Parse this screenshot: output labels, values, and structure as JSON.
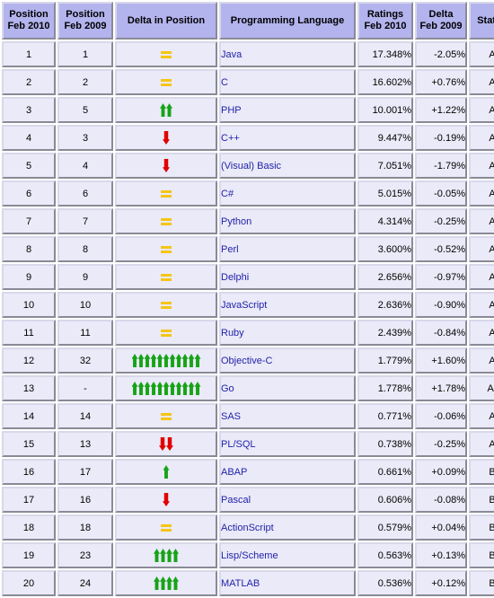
{
  "table": {
    "headers": [
      {
        "line1": "Position",
        "line2": "Feb 2010",
        "name": "position-2010"
      },
      {
        "line1": "Position",
        "line2": "Feb 2009",
        "name": "position-2009"
      },
      {
        "line1": "Delta in Position",
        "line2": "",
        "name": "delta-in-position"
      },
      {
        "line1": "Programming Language",
        "line2": "",
        "name": "programming-language"
      },
      {
        "line1": "Ratings",
        "line2": "Feb 2010",
        "name": "ratings-2010"
      },
      {
        "line1": "Delta",
        "line2": "Feb 2009",
        "name": "delta-2009"
      },
      {
        "line1": "Status",
        "line2": "",
        "name": "status"
      }
    ],
    "colors": {
      "header_bg": "#b3b3ee",
      "cell_bg": "#eaeaf8",
      "border": "#d8d8ea",
      "link": "#2222aa",
      "arrow_up": "#17a317",
      "arrow_down": "#e00000",
      "equal": "#f5c518"
    },
    "rows": [
      {
        "pos2010": "1",
        "pos2009": "1",
        "delta_dir": "equal",
        "delta_count": 1,
        "language": "Java",
        "ratings": "17.348%",
        "delta": "-2.05%",
        "status": "A"
      },
      {
        "pos2010": "2",
        "pos2009": "2",
        "delta_dir": "equal",
        "delta_count": 1,
        "language": "C",
        "ratings": "16.602%",
        "delta": "+0.76%",
        "status": "A"
      },
      {
        "pos2010": "3",
        "pos2009": "5",
        "delta_dir": "up",
        "delta_count": 2,
        "language": "PHP",
        "ratings": "10.001%",
        "delta": "+1.22%",
        "status": "A"
      },
      {
        "pos2010": "4",
        "pos2009": "3",
        "delta_dir": "down",
        "delta_count": 1,
        "language": "C++",
        "ratings": "9.447%",
        "delta": "-0.19%",
        "status": "A"
      },
      {
        "pos2010": "5",
        "pos2009": "4",
        "delta_dir": "down",
        "delta_count": 1,
        "language": "(Visual) Basic",
        "ratings": "7.051%",
        "delta": "-1.79%",
        "status": "A"
      },
      {
        "pos2010": "6",
        "pos2009": "6",
        "delta_dir": "equal",
        "delta_count": 1,
        "language": "C#",
        "ratings": "5.015%",
        "delta": "-0.05%",
        "status": "A"
      },
      {
        "pos2010": "7",
        "pos2009": "7",
        "delta_dir": "equal",
        "delta_count": 1,
        "language": "Python",
        "ratings": "4.314%",
        "delta": "-0.25%",
        "status": "A"
      },
      {
        "pos2010": "8",
        "pos2009": "8",
        "delta_dir": "equal",
        "delta_count": 1,
        "language": "Perl",
        "ratings": "3.600%",
        "delta": "-0.52%",
        "status": "A"
      },
      {
        "pos2010": "9",
        "pos2009": "9",
        "delta_dir": "equal",
        "delta_count": 1,
        "language": "Delphi",
        "ratings": "2.656%",
        "delta": "-0.97%",
        "status": "A"
      },
      {
        "pos2010": "10",
        "pos2009": "10",
        "delta_dir": "equal",
        "delta_count": 1,
        "language": "JavaScript",
        "ratings": "2.636%",
        "delta": "-0.90%",
        "status": "A"
      },
      {
        "pos2010": "11",
        "pos2009": "11",
        "delta_dir": "equal",
        "delta_count": 1,
        "language": "Ruby",
        "ratings": "2.439%",
        "delta": "-0.84%",
        "status": "A"
      },
      {
        "pos2010": "12",
        "pos2009": "32",
        "delta_dir": "up",
        "delta_count": 11,
        "language": "Objective-C",
        "ratings": "1.779%",
        "delta": "+1.60%",
        "status": "A"
      },
      {
        "pos2010": "13",
        "pos2009": "-",
        "delta_dir": "up",
        "delta_count": 11,
        "language": "Go",
        "ratings": "1.778%",
        "delta": "+1.78%",
        "status": "A-"
      },
      {
        "pos2010": "14",
        "pos2009": "14",
        "delta_dir": "equal",
        "delta_count": 1,
        "language": "SAS",
        "ratings": "0.771%",
        "delta": "-0.06%",
        "status": "A"
      },
      {
        "pos2010": "15",
        "pos2009": "13",
        "delta_dir": "down",
        "delta_count": 2,
        "language": "PL/SQL",
        "ratings": "0.738%",
        "delta": "-0.25%",
        "status": "A"
      },
      {
        "pos2010": "16",
        "pos2009": "17",
        "delta_dir": "up",
        "delta_count": 1,
        "language": "ABAP",
        "ratings": "0.661%",
        "delta": "+0.09%",
        "status": "B"
      },
      {
        "pos2010": "17",
        "pos2009": "16",
        "delta_dir": "down",
        "delta_count": 1,
        "language": "Pascal",
        "ratings": "0.606%",
        "delta": "-0.08%",
        "status": "B"
      },
      {
        "pos2010": "18",
        "pos2009": "18",
        "delta_dir": "equal",
        "delta_count": 1,
        "language": "ActionScript",
        "ratings": "0.579%",
        "delta": "+0.04%",
        "status": "B"
      },
      {
        "pos2010": "19",
        "pos2009": "23",
        "delta_dir": "up",
        "delta_count": 4,
        "language": "Lisp/Scheme",
        "ratings": "0.563%",
        "delta": "+0.13%",
        "status": "B"
      },
      {
        "pos2010": "20",
        "pos2009": "24",
        "delta_dir": "up",
        "delta_count": 4,
        "language": "MATLAB",
        "ratings": "0.536%",
        "delta": "+0.12%",
        "status": "B"
      }
    ]
  }
}
